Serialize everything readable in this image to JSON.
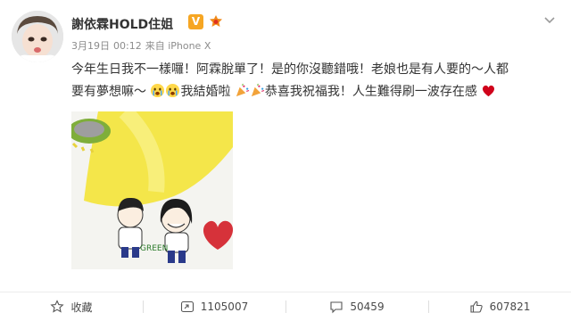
{
  "post": {
    "author": "謝依霖HOLD住姐",
    "date": "3月19日",
    "time": "00:12",
    "source": "来自 iPhone X",
    "text_line1": "今年生日我不一樣囉！阿霖脫單了！是的你沒聽錯哦！老娘也是有人要的～人都",
    "text_line2_a": "要有夢想嘛～",
    "text_line2_b": "我結婚啦",
    "text_line2_c": "恭喜我祝福我！人生難得刷一波存在感",
    "photo_caption": "GREEN"
  },
  "actions": {
    "favorite_label": "收藏",
    "repost_count": "1105007",
    "comment_count": "50459",
    "like_count": "607821"
  },
  "colors": {
    "vip": "#f6a623",
    "text": "#333333",
    "meta": "#8c8c8c",
    "heart": "#d0021b",
    "yellow": "#f4e64a"
  },
  "icons": [
    "chevron-down-icon",
    "vip-badge",
    "member-badge",
    "crying-emoji",
    "party-popper-emoji",
    "red-heart-emoji",
    "star-icon",
    "repost-icon",
    "comment-icon",
    "thumbs-up-icon"
  ]
}
